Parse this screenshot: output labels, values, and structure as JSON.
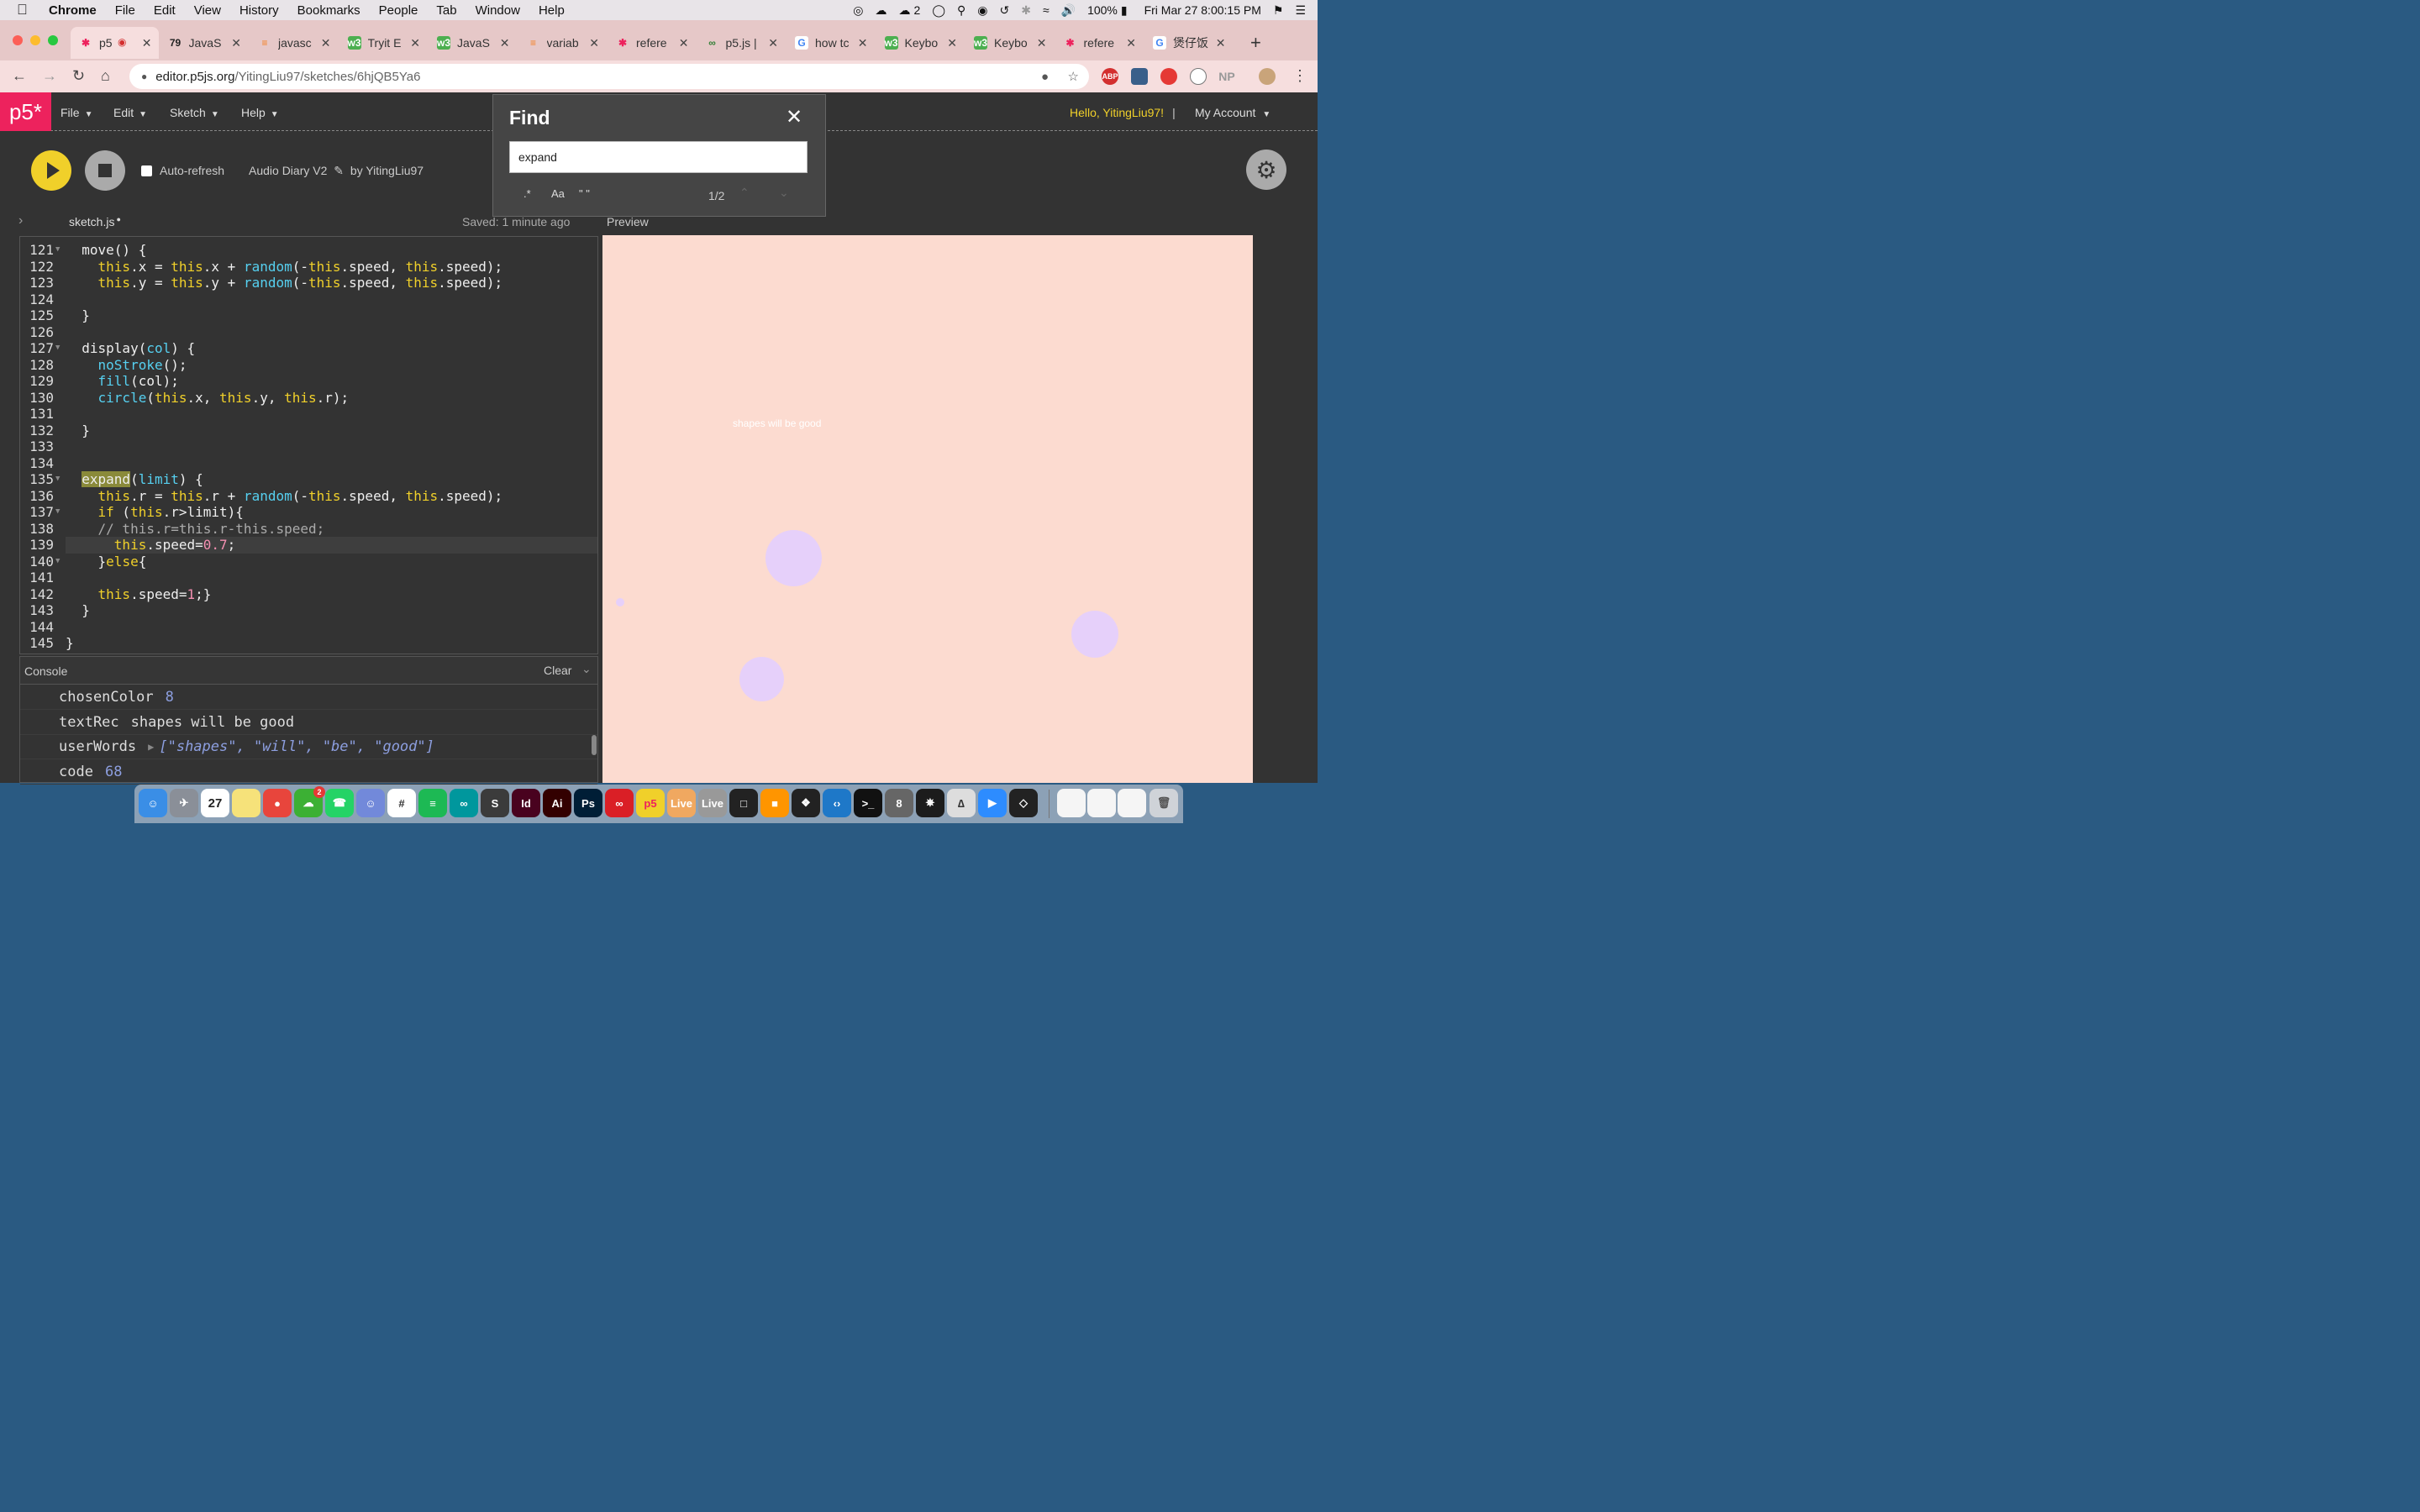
{
  "menubar": {
    "app": "Chrome",
    "items": [
      "File",
      "Edit",
      "View",
      "History",
      "Bookmarks",
      "People",
      "Tab",
      "Window",
      "Help"
    ],
    "wechat_count": "2",
    "battery": "100%",
    "datetime": "Fri Mar 27  8:00:15 PM"
  },
  "tabs": [
    {
      "icon": "p5-asterisk-icon",
      "title": "p5",
      "active": true
    },
    {
      "icon": "79",
      "title": "JavaS"
    },
    {
      "icon": "stack-icon",
      "title": "javasc"
    },
    {
      "icon": "w3-icon",
      "title": "Tryit E"
    },
    {
      "icon": "w3-icon",
      "title": "JavaS"
    },
    {
      "icon": "stack-icon",
      "title": "variab"
    },
    {
      "icon": "p5-asterisk-icon",
      "title": "refere"
    },
    {
      "icon": "ml5-icon",
      "title": "p5.js |"
    },
    {
      "icon": "google-icon",
      "title": "how tc"
    },
    {
      "icon": "w3-icon",
      "title": "Keybo"
    },
    {
      "icon": "w3-icon",
      "title": "Keybo"
    },
    {
      "icon": "p5-asterisk-icon",
      "title": "refere"
    },
    {
      "icon": "google-icon",
      "title": "煲仔饭"
    }
  ],
  "url": {
    "host": "editor.p5js.org",
    "path": "/YitingLiu97/sketches/6hjQB5Ya6"
  },
  "extensions": [
    "ABP",
    "NP"
  ],
  "p5": {
    "logo": "p5*",
    "menus": [
      "File",
      "Edit",
      "Sketch",
      "Help"
    ],
    "hello": "Hello, YitingLiu97!",
    "account": "My Account",
    "auto_refresh": "Auto-refresh",
    "sketch_name": "Audio Diary V2",
    "author": "by YitingLiu97",
    "file_name": "sketch.js",
    "saved": "Saved: 1 minute ago",
    "preview_label": "Preview"
  },
  "code_lines": [
    {
      "n": "121",
      "fold": true,
      "html": "  move() {"
    },
    {
      "n": "122",
      "html": "    <span class=\"kw\">this</span>.x = <span class=\"kw\">this</span>.x + <span class=\"fn\">random</span>(-<span class=\"kw\">this</span>.speed, <span class=\"kw\">this</span>.speed);"
    },
    {
      "n": "123",
      "html": "    <span class=\"kw\">this</span>.y = <span class=\"kw\">this</span>.y + <span class=\"fn\">random</span>(-<span class=\"kw\">this</span>.speed, <span class=\"kw\">this</span>.speed);"
    },
    {
      "n": "124",
      "html": ""
    },
    {
      "n": "125",
      "html": "  }"
    },
    {
      "n": "126",
      "html": ""
    },
    {
      "n": "127",
      "fold": true,
      "html": "  display(<span class=\"fn\">col</span>) {"
    },
    {
      "n": "128",
      "html": "    <span class=\"fn\">noStroke</span>();"
    },
    {
      "n": "129",
      "html": "    <span class=\"fn\">fill</span>(col);"
    },
    {
      "n": "130",
      "html": "    <span class=\"fn\">circle</span>(<span class=\"kw\">this</span>.x, <span class=\"kw\">this</span>.y, <span class=\"kw\">this</span>.r);"
    },
    {
      "n": "131",
      "html": ""
    },
    {
      "n": "132",
      "html": "  }"
    },
    {
      "n": "133",
      "html": ""
    },
    {
      "n": "134",
      "html": ""
    },
    {
      "n": "135",
      "fold": true,
      "html": "  <span class=\"hl\">expand</span>(<span class=\"fn\">limit</span>) {"
    },
    {
      "n": "136",
      "html": "    <span class=\"kw\">this</span>.r = <span class=\"kw\">this</span>.r + <span class=\"fn\">random</span>(-<span class=\"kw\">this</span>.speed, <span class=\"kw\">this</span>.speed);"
    },
    {
      "n": "137",
      "fold": true,
      "html": "    <span class=\"kw\">if</span> (<span class=\"kw\">this</span>.r&gt;limit){"
    },
    {
      "n": "138",
      "html": "    <span class=\"cm\">// this.r=this.r-this.speed;</span>"
    },
    {
      "n": "139",
      "current": true,
      "html": "      <span class=\"kw\">this</span>.speed=<span class=\"num\">0.7</span>;"
    },
    {
      "n": "140",
      "fold": true,
      "html": "    }<span class=\"kw\">else</span>{"
    },
    {
      "n": "141",
      "html": ""
    },
    {
      "n": "142",
      "html": "    <span class=\"kw\">this</span>.speed=<span class=\"num\">1</span>;}"
    },
    {
      "n": "143",
      "html": "  }"
    },
    {
      "n": "144",
      "html": ""
    },
    {
      "n": "145",
      "html": "}"
    }
  ],
  "console": {
    "label": "Console",
    "clear": "Clear",
    "rows": [
      {
        "key": "chosenColor",
        "value": "8",
        "kind": "num"
      },
      {
        "key": "textRec",
        "value": "shapes will be good",
        "kind": "str"
      },
      {
        "key": "userWords",
        "value": "[\"shapes\", \"will\", \"be\", \"good\"]",
        "kind": "arr"
      },
      {
        "key": "code",
        "value": "68",
        "kind": "num"
      }
    ]
  },
  "preview": {
    "text": "shapes will be good",
    "background": "#fcdbd0",
    "circle_color": "#e6d0fa"
  },
  "find": {
    "title": "Find",
    "query": "expand",
    "opt_regex": ".*",
    "opt_case": "Aa",
    "opt_word": "\" \"",
    "count": "1/2"
  },
  "dock": {
    "calendar_day": "27",
    "wechat_badge": "2",
    "apps": [
      "Finder",
      "Launchpad",
      "Calendar",
      "Notes",
      "Chrome",
      "WeChat",
      "WhatsApp",
      "Discord",
      "Slack",
      "Spotify",
      "Arduino",
      "Sublime",
      "InDesign",
      "Illustrator",
      "Photoshop",
      "Creative Cloud",
      "p5",
      "Live",
      "Live",
      "Terminal",
      "Books",
      "Figma",
      "VS Code",
      "Terminal",
      "8",
      "Processing",
      "Touchdesigner",
      "Zoom",
      "Unity"
    ]
  }
}
